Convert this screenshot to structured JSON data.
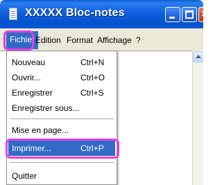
{
  "window": {
    "title": "XXXXX  Bloc-notes"
  },
  "titlebar": {
    "icon": "notepad-icon",
    "buttons": [
      "minimize",
      "maximize",
      "close"
    ],
    "close_glyph": "×"
  },
  "menubar": {
    "items": [
      {
        "label": "Fichier",
        "active": true
      },
      {
        "label": "Edition"
      },
      {
        "label": "Format"
      },
      {
        "label": "Affichage"
      },
      {
        "label": "?"
      }
    ]
  },
  "menu": {
    "items": [
      {
        "label": "Nouveau",
        "shortcut": "Ctrl+N"
      },
      {
        "label": "Ouvrir...",
        "shortcut": "Ctrl+O"
      },
      {
        "label": "Enregistrer",
        "shortcut": "Ctrl+S"
      },
      {
        "label": "Enregistrer sous..."
      },
      {
        "label": "Mise en page..."
      },
      {
        "label": "Imprimer...",
        "shortcut": "Ctrl+P",
        "selected": true
      },
      {
        "label": "Quitter"
      }
    ]
  },
  "colors": {
    "highlight": "#316ac5",
    "callout": "#e040e0",
    "titlebar": "#0453cc"
  }
}
